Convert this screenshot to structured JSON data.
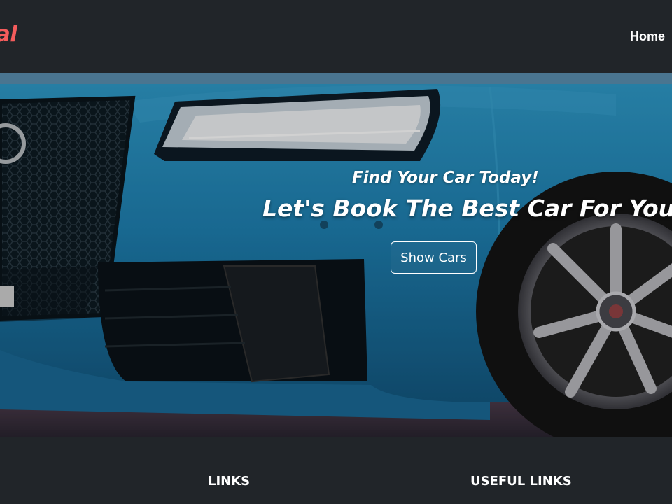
{
  "navbar": {
    "brand": "ntal",
    "home_link": "Home"
  },
  "hero": {
    "kicker": "Find Your Car Today!",
    "title": "Let's Book The Best Car For You",
    "button_label": "Show Cars"
  },
  "footer": {
    "links_heading": "LINKS",
    "useful_links_heading": "USEFUL LINKS"
  },
  "colors": {
    "background": "#212529",
    "brand": "#f45c5c",
    "car_body": "#1e7fb0"
  }
}
